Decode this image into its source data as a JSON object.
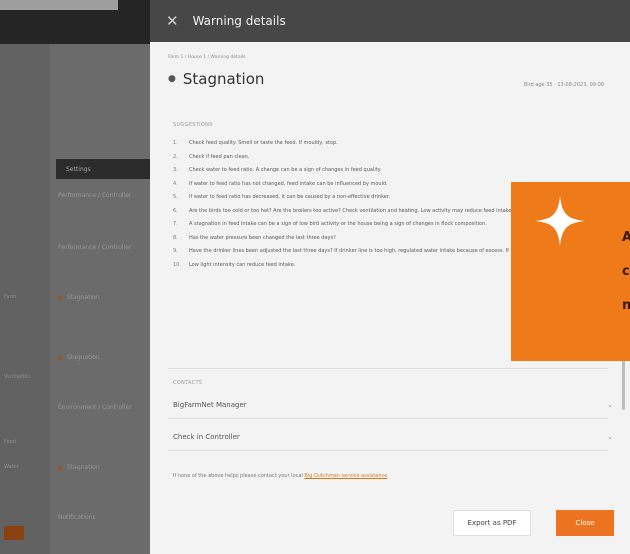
{
  "background": {
    "nav_items": [
      {
        "label": "Settings",
        "active": true
      },
      {
        "label": "Performance / Controller",
        "active": false
      },
      {
        "label": "Performance / Controller",
        "active": false
      },
      {
        "label": "Stagnation",
        "active": false,
        "dot": true
      },
      {
        "label": "Stagnation",
        "active": false,
        "dot": true
      },
      {
        "label": "Environment / Controller",
        "active": false
      },
      {
        "label": "Stagnation",
        "active": false,
        "dot": true
      },
      {
        "label": "Notifications",
        "active": false
      }
    ],
    "left_labels": [
      "Farm",
      "Ventilation",
      "Feed",
      "Water"
    ]
  },
  "drawer": {
    "header_title": "Warning details",
    "breadcrumb": "Farm 1 / House 1 / Warning details",
    "page_title": "Stagnation",
    "meta": "Bird age 35 · 13-08-2023, 09:00",
    "suggestions_label": "SUGGESTIONS",
    "suggestions": [
      {
        "n": "1.",
        "text": "Check feed quality. Smell or taste the feed. If mouldy, stop."
      },
      {
        "n": "2.",
        "text": "Check if feed pan clean."
      },
      {
        "n": "3.",
        "text": "Check water to feed ratio. A change can be a sign of changes in feed quality."
      },
      {
        "n": "4.",
        "text": "If water to feed ratio has not changed, feed intake can be influenced by mould."
      },
      {
        "n": "5.",
        "text": "If water to feed ratio has decreased, it can be caused by a non-effective drinker."
      },
      {
        "n": "6.",
        "text": "Are the birds too cold or too hot? Are the broilers too active? Check ventilation and heating. Low activity may reduce feed intake."
      },
      {
        "n": "7.",
        "text": "A stagnation in feed intake can be a sign of low bird activity or the house being a sign of changes in flock composition."
      },
      {
        "n": "8.",
        "text": "Has the water pressure been changed the last three days?"
      },
      {
        "n": "9.",
        "text": "Have the drinker lines been adjusted the last three days? If drinker line is too high, regulated water intake because of excess. If drinker line is too high, it can result."
      },
      {
        "n": "10.",
        "text": "Low light intensity can reduce feed intake."
      }
    ],
    "contacts_label": "CONTACTS",
    "contacts": [
      "BigFarmNet Manager",
      "Check in Controller"
    ],
    "footnote_text": "If none of the above helps please contact your local",
    "footnote_link": "Big Dutchman service assistance",
    "export_label": "Export as PDF",
    "close_label": "Close"
  },
  "promo": {
    "lines": [
      "A",
      "c",
      "n"
    ]
  }
}
